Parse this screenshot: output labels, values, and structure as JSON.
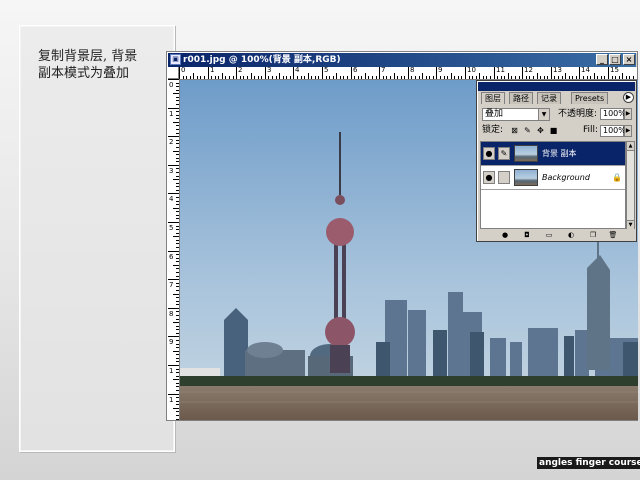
{
  "note": {
    "line1": "复制背景层, 背景",
    "line2": "副本模式为叠加"
  },
  "window": {
    "title": "r001.jpg @ 100%(背景 副本,RGB)",
    "controls": [
      "_",
      "□",
      "×"
    ],
    "ruler_top_ticks": [
      "0",
      "1",
      "2",
      "3",
      "4",
      "5",
      "6",
      "7",
      "8",
      "9",
      "10",
      "11",
      "12",
      "13",
      "14",
      "15"
    ],
    "ruler_left_ticks": [
      "0",
      "1",
      "2",
      "3",
      "4",
      "5",
      "6",
      "7",
      "8",
      "9",
      "1",
      "1"
    ]
  },
  "palette": {
    "tabs": [
      "图层",
      "路径",
      "记录",
      "Presets"
    ],
    "blend_mode": "叠加",
    "opacity_label": "不透明度:",
    "opacity_value": "100%",
    "lock_label": "锁定:",
    "fill_label": "Fill:",
    "fill_value": "100%",
    "layers": [
      {
        "name": "背景 副本",
        "selected": true
      },
      {
        "name": "Background",
        "selected": false
      }
    ]
  },
  "credit": "angles finger course",
  "colors": {
    "titlebar": "#0a246a",
    "selection": "#0a246a",
    "chrome": "#d4d0c8"
  }
}
